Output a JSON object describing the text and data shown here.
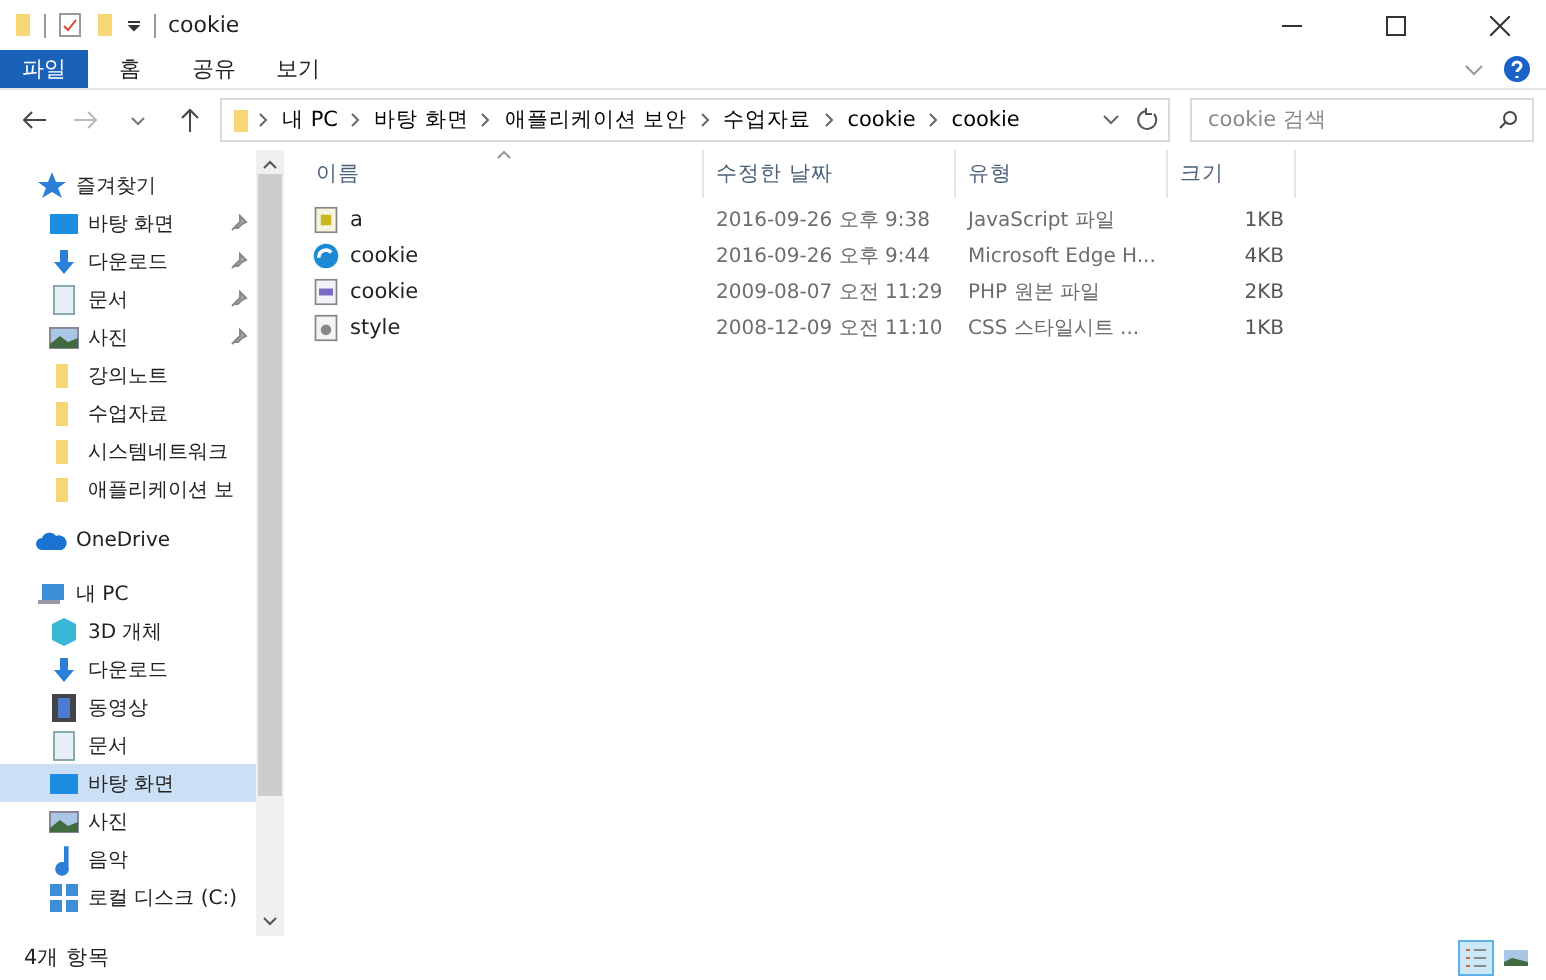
{
  "window": {
    "title": "cookie"
  },
  "ribbon_tabs": [
    {
      "label": "파일",
      "selected": true
    },
    {
      "label": "홈",
      "selected": false
    },
    {
      "label": "공유",
      "selected": false
    },
    {
      "label": "보기",
      "selected": false
    }
  ],
  "breadcrumb": [
    "내 PC",
    "바탕 화면",
    "애플리케이션 보안",
    "수업자료",
    "cookie",
    "cookie"
  ],
  "search": {
    "placeholder": "cookie 검색"
  },
  "sidebar": {
    "items": [
      {
        "label": "즐겨찾기",
        "kind": "star",
        "selected": false,
        "children": [
          {
            "label": "바탕 화면",
            "kind": "desktop",
            "pinned": true,
            "selected": false
          },
          {
            "label": "다운로드",
            "kind": "download",
            "pinned": true,
            "selected": false
          },
          {
            "label": "문서",
            "kind": "document",
            "pinned": true,
            "selected": false
          },
          {
            "label": "사진",
            "kind": "pictures",
            "pinned": true,
            "selected": false
          },
          {
            "label": "강의노트",
            "kind": "folder",
            "pinned": false,
            "selected": false
          },
          {
            "label": "수업자료",
            "kind": "folder",
            "pinned": false,
            "selected": false
          },
          {
            "label": "시스템네트워크",
            "kind": "folder",
            "pinned": false,
            "selected": false
          },
          {
            "label": "애플리케이션 보",
            "kind": "folder",
            "pinned": false,
            "selected": false
          }
        ]
      },
      {
        "label": "OneDrive",
        "kind": "cloud",
        "selected": false
      },
      {
        "label": "내 PC",
        "kind": "pc",
        "selected": false,
        "children": [
          {
            "label": "3D 개체",
            "kind": "cube",
            "selected": false
          },
          {
            "label": "다운로드",
            "kind": "download",
            "selected": false
          },
          {
            "label": "동영상",
            "kind": "video",
            "selected": false
          },
          {
            "label": "문서",
            "kind": "document",
            "selected": false
          },
          {
            "label": "바탕 화면",
            "kind": "desktop",
            "selected": true
          },
          {
            "label": "사진",
            "kind": "pictures",
            "selected": false
          },
          {
            "label": "음악",
            "kind": "music",
            "selected": false
          },
          {
            "label": "로컬 디스크 (C:)",
            "kind": "drive",
            "selected": false
          }
        ]
      }
    ]
  },
  "table": {
    "columns": [
      "이름",
      "수정한 날짜",
      "유형",
      "크기"
    ],
    "rows": [
      {
        "kind": "js",
        "name": "a",
        "modified": "2016-09-26 오후 9:38",
        "type": "JavaScript 파일",
        "size": "1KB"
      },
      {
        "kind": "edge",
        "name": "cookie",
        "modified": "2016-09-26 오후 9:44",
        "type": "Microsoft Edge H...",
        "size": "4KB"
      },
      {
        "kind": "php",
        "name": "cookie",
        "modified": "2009-08-07 오전 11:29",
        "type": "PHP 원본 파일",
        "size": "2KB"
      },
      {
        "kind": "css",
        "name": "style",
        "modified": "2008-12-09 오전 11:10",
        "type": "CSS 스타일시트 ...",
        "size": "1KB"
      }
    ]
  },
  "status_bar": {
    "count": "4개 항목"
  },
  "view_modes": [
    {
      "kind": "details",
      "selected": true
    },
    {
      "kind": "thumbnails",
      "selected": false
    }
  ]
}
